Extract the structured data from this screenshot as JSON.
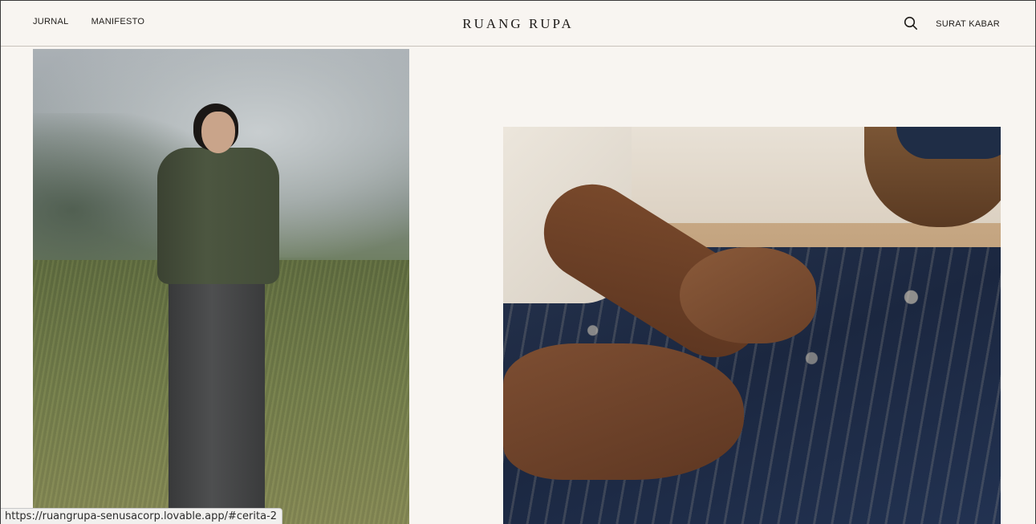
{
  "header": {
    "nav_left": [
      {
        "label": "JURNAL"
      },
      {
        "label": "MANIFESTO"
      }
    ],
    "brand": "RUANG RUPA",
    "search_icon": "search-icon",
    "newsletter_label": "SURAT KABAR"
  },
  "gallery": {
    "left_image_icon": "portrait-photo",
    "right_image_icon": "textile-hands-photo"
  },
  "status_bar": {
    "url": "https://ruangrupa-senusacorp.lovable.app/#cerita-2"
  },
  "colors": {
    "background": "#f8f5f1",
    "text": "#1f1c19",
    "divider": "#c9c3bb"
  }
}
